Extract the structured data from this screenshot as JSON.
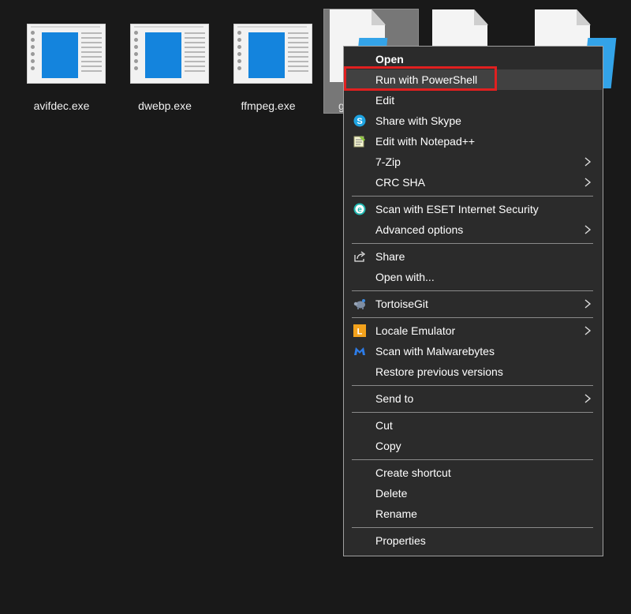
{
  "files": [
    {
      "name": "avifdec.exe"
    },
    {
      "name": "dwebp.exe"
    },
    {
      "name": "ffmpeg.exe"
    }
  ],
  "selected_file": {
    "partial_label": "g"
  },
  "menu": {
    "open": "Open",
    "run_powershell": "Run with PowerShell",
    "edit": "Edit",
    "share_skype": "Share with Skype",
    "edit_notepadpp": "Edit with Notepad++",
    "seven_zip": "7-Zip",
    "crc_sha": "CRC SHA",
    "scan_eset": "Scan with ESET Internet Security",
    "advanced_options": "Advanced options",
    "share": "Share",
    "open_with": "Open with...",
    "tortoisegit": "TortoiseGit",
    "locale_emulator": "Locale Emulator",
    "scan_malwarebytes": "Scan with Malwarebytes",
    "restore_versions": "Restore previous versions",
    "send_to": "Send to",
    "cut": "Cut",
    "copy": "Copy",
    "create_shortcut": "Create shortcut",
    "delete": "Delete",
    "rename": "Rename",
    "properties": "Properties",
    "icons": {
      "share_skype": "skype-icon",
      "edit_notepadpp": "notepadpp-icon",
      "scan_eset": "eset-icon",
      "share": "share-icon",
      "tortoisegit": "tortoisegit-icon",
      "locale_emulator": "locale-emulator-icon",
      "scan_malwarebytes": "malwarebytes-icon",
      "submenu_arrow": "chevron-right-icon"
    },
    "locale_emulator_letter": "L",
    "eset_letter": "e",
    "skype_letter": "S"
  },
  "colors": {
    "background": "#191919",
    "menu_background": "#2b2b2b",
    "menu_hover": "#414141",
    "highlight_box": "#e02020",
    "file_blue": "#1484dd"
  }
}
